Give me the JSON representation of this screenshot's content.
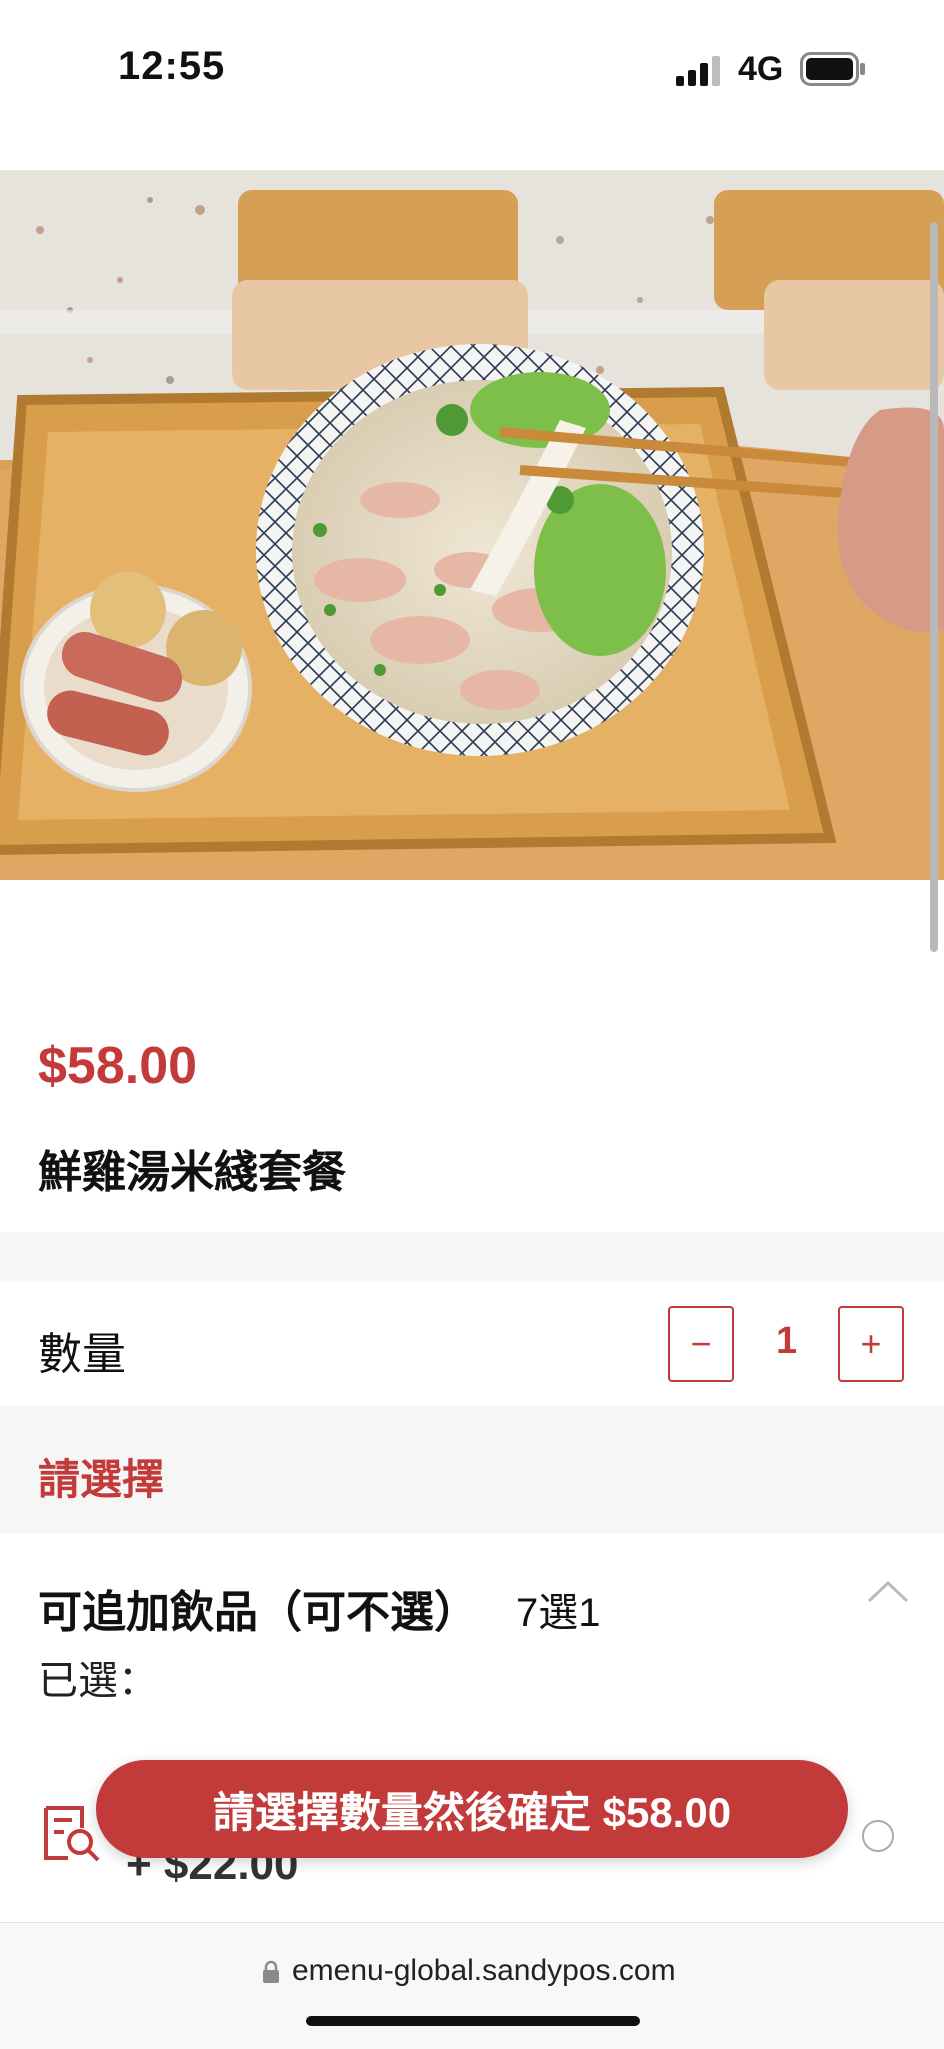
{
  "status_bar": {
    "time": "12:55",
    "network": "4G"
  },
  "product": {
    "price": "$58.00",
    "name": "鮮雞湯米綫套餐",
    "image_icon": "noodle-soup-photo"
  },
  "quantity": {
    "label": "數量",
    "value": "1",
    "minus": "−",
    "plus": "+"
  },
  "section": {
    "title": "請選擇"
  },
  "option_group": {
    "title": "可追加飲品（可不選）",
    "rule": "7選1",
    "selected_label": "已選："
  },
  "option_item": {
    "price": "+ $22.00",
    "icon": "search-document-icon"
  },
  "confirm_button": {
    "label": "請選擇數量然後確定 $58.00"
  },
  "browser": {
    "url": "emenu-global.sandypos.com"
  },
  "colors": {
    "accent": "#c33a3a"
  }
}
